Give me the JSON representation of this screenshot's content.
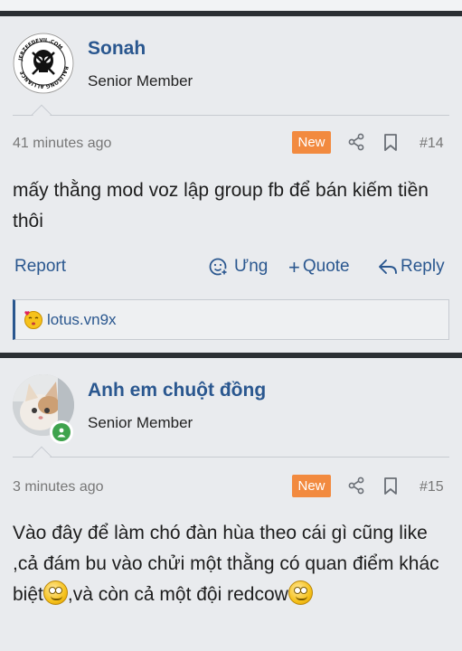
{
  "posts": [
    {
      "username": "Sonah",
      "user_title": "Senior Member",
      "avatar_text_top": "JERZEEDEVIL.COM",
      "avatar_text_bottom": "BALISONG ALLIANCE",
      "time": "41 minutes ago",
      "badge": "New",
      "post_number": "#14",
      "body": "mấy thằng mod voz lập group fb để bán kiếm tiền thôi",
      "actions": {
        "report": "Report",
        "react": "Ưng",
        "quote": "Quote",
        "reply": "Reply"
      },
      "signature": "lotus.vn9x"
    },
    {
      "username": "Anh em chuột đồng",
      "user_title": "Senior Member",
      "time": "3 minutes ago",
      "badge": "New",
      "post_number": "#15",
      "body_parts": [
        "Vào đây để làm chó đàn hùa theo cái gì cũng like ,cả đám bu vào chửi một thằng có quan điểm khác biệt",
        ",và còn cả một đội redcow"
      ]
    }
  ],
  "colors": {
    "link": "#2a578f",
    "badge": "#f28a3f",
    "separator": "#2b2f33",
    "online": "#3fa34d"
  },
  "icons": [
    "share-icon",
    "bookmark-icon",
    "react-icon",
    "plus-icon",
    "reply-arrow-icon",
    "online-status-icon",
    "smile-emoji-icon"
  ]
}
